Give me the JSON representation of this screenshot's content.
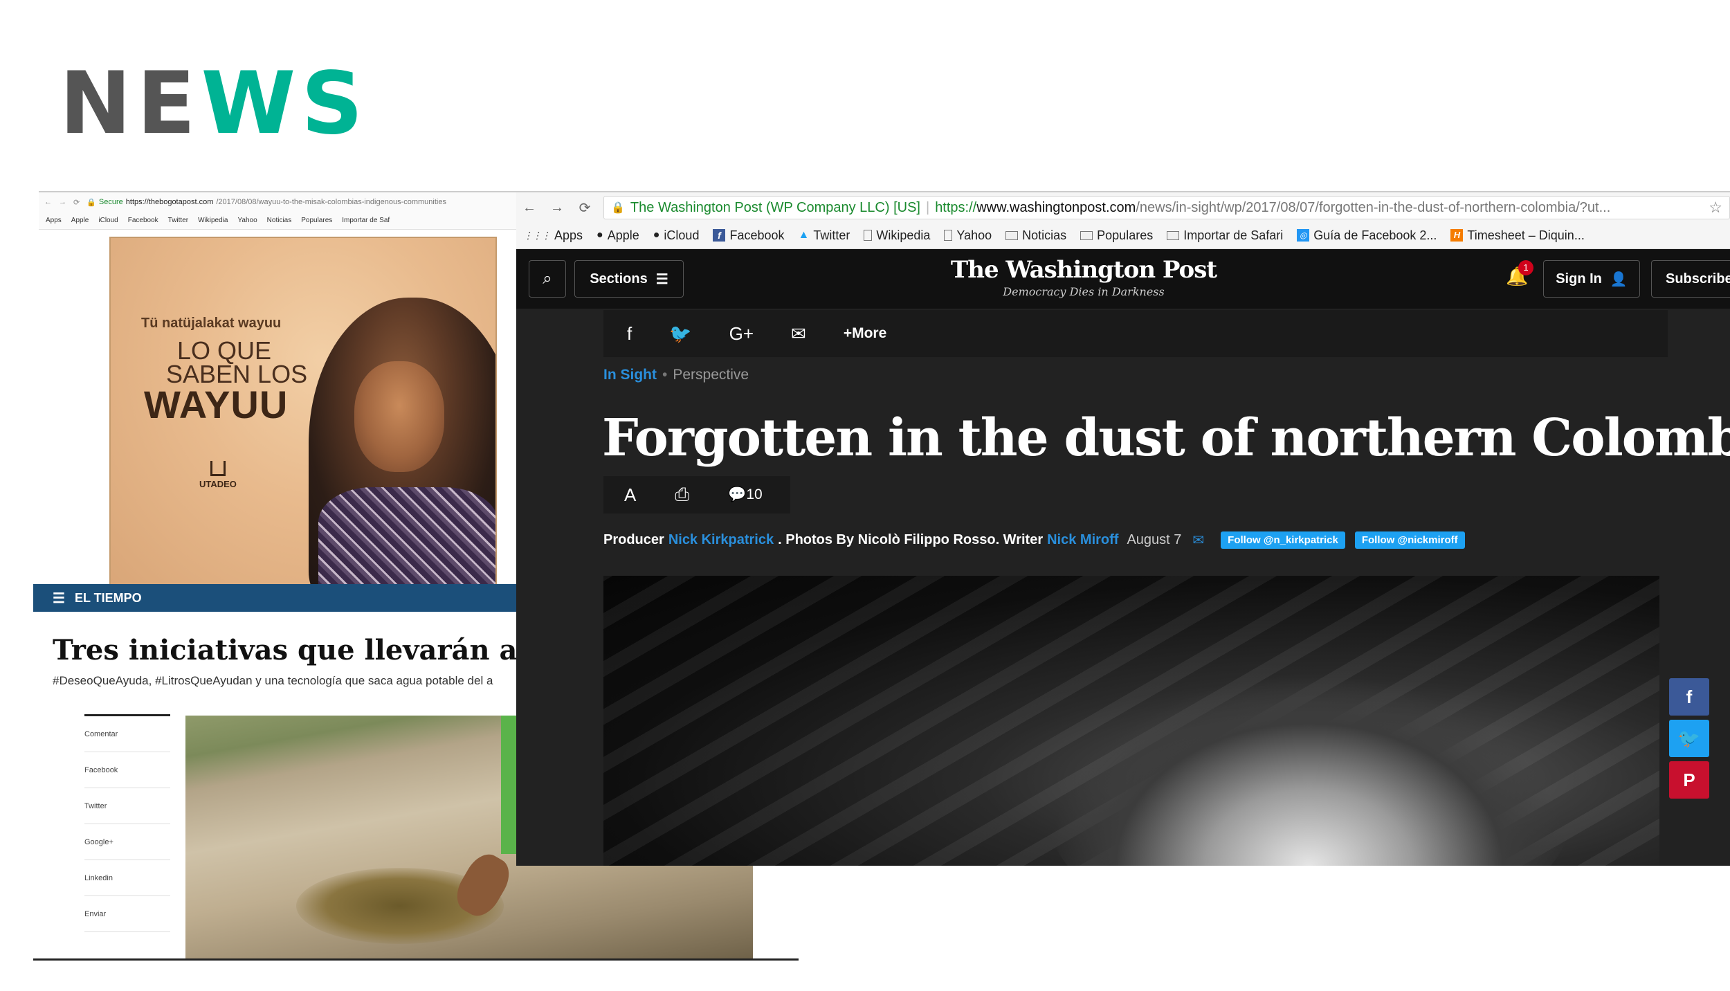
{
  "heading": {
    "part1": "NE",
    "part2": "WS"
  },
  "bogota": {
    "url_secure": "Secure",
    "url_host": "https://thebogotapost.com",
    "url_path": "/2017/08/08/wayuu-to-the-misak-colombias-indigenous-communities",
    "bookmarks": [
      "Apps",
      "Apple",
      "iCloud",
      "Facebook",
      "Twitter",
      "Wikipedia",
      "Yahoo",
      "Noticias",
      "Populares",
      "Importar de Saf"
    ],
    "book": {
      "subtitle": "Tü natüjalakat wayuu",
      "line1": "LO QUE",
      "line2": "SABEN LOS",
      "line3": "WAYUU",
      "publisher": "UTADEO"
    }
  },
  "tiempo": {
    "brand": "EL TIEMPO",
    "title": "Tres iniciativas que llevarán agua",
    "subtitle": "#DeseoQueAyuda, #LitrosQueAyudan y una tecnología que saca agua potable del a",
    "share_items": [
      "Comentar",
      "Facebook",
      "Twitter",
      "Google+",
      "Linkedin",
      "Enviar"
    ]
  },
  "wp": {
    "url_org": "The Washington Post (WP Company LLC) [US]",
    "url_proto": "https://",
    "url_host": "www.washingtonpost.com",
    "url_path": "/news/in-sight/wp/2017/08/07/forgotten-in-the-dust-of-northern-colombia/?ut...",
    "bookmarks": [
      "Apps",
      "Apple",
      "iCloud",
      "Facebook",
      "Twitter",
      "Wikipedia",
      "Yahoo",
      "Noticias",
      "Populares",
      "Importar de Safari",
      "Guía de Facebook 2...",
      "Timesheet – Diquin..."
    ],
    "sections": "Sections",
    "logo": "The Washington Post",
    "tagline": "Democracy Dies in Darkness",
    "notifications": "1",
    "sign_in": "Sign In",
    "subscribe": "Subscribe",
    "share_more": "More",
    "kicker": "In Sight",
    "kicker_type": "Perspective",
    "headline": "Forgotten in the dust of northern Colombia",
    "comments": "10",
    "byline": {
      "producer_label": "Producer",
      "producer": "Nick Kirkpatrick",
      "photos": ". Photos By Nicolò Filippo Rosso. Writer",
      "writer": "Nick Miroff",
      "date": "August 7",
      "follow1": "Follow @n_kirkpatrick",
      "follow2": "Follow @nickmiroff"
    }
  },
  "colors": {
    "accent": "#00b394",
    "heading_gray": "#555555",
    "wp_link": "#2a8fdc",
    "tiempo_bar": "#1b4f7a",
    "twitter": "#1da1f2",
    "facebook": "#3b5998",
    "pinterest": "#c8102e"
  }
}
